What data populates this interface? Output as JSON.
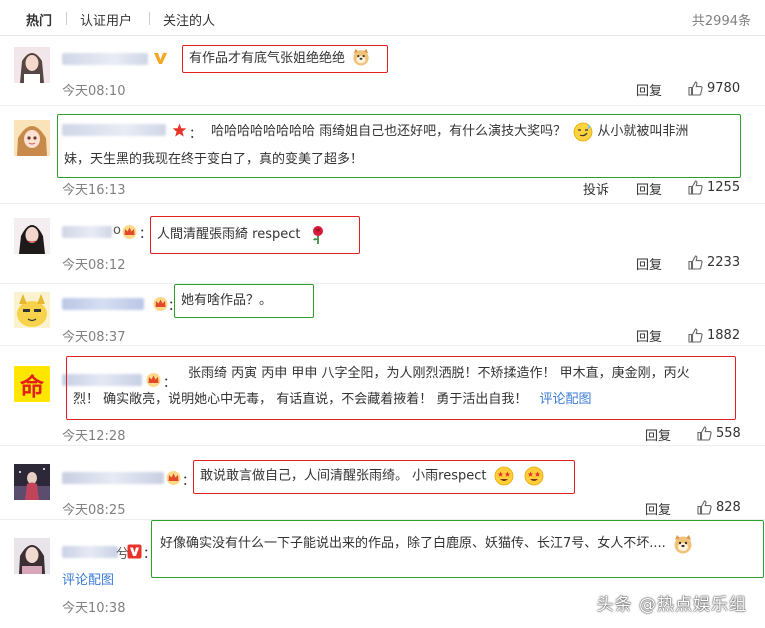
{
  "tabs": [
    "热门",
    "认证用户",
    "关注的人"
  ],
  "total": "共2994条",
  "actions": {
    "reply": "回复",
    "report": "投诉"
  },
  "comments": [
    {
      "text": "有作品才有底气张姐绝绝绝",
      "time": "今天08:10",
      "likes": "9780"
    },
    {
      "text": "哈哈哈哈哈哈哈哈 雨绮姐自己也还好吧，有什么演技大奖吗？",
      "text2": "从小就被叫非洲",
      "text3": "妹，天生黑的我现在终于变白了，真的变美了超多！",
      "time": "今天16:13",
      "likes": "1255"
    },
    {
      "text": "人間清醒張雨綺 respect",
      "time": "今天08:12",
      "likes": "2233"
    },
    {
      "text": "她有啥作品？。",
      "time": "今天08:37",
      "likes": "1882"
    },
    {
      "text": "张雨绮 丙寅 丙申 甲申 八字全阳，为人刚烈洒脱！不矫揉造作！ 甲木直，庚金刚，丙火",
      "text2": "烈！ 确实敞亮，说明她心中无毒， 有话直说，不会藏着掖着！ 勇于活出自我！",
      "link": "评论配图",
      "time": "今天12:28",
      "likes": "558",
      "avatar_char": "命"
    },
    {
      "text": "敢说敢言做自己，人间清醒张雨绮。 小雨respect",
      "time": "今天08:25",
      "likes": "828"
    },
    {
      "text": "好像确实没有什么一下子能说出来的作品，除了白鹿原、妖猫传、长江7号、女人不坏....",
      "link": "评论配图",
      "time": "今天10:38"
    }
  ],
  "watermark": "头条 @热点娱乐组"
}
